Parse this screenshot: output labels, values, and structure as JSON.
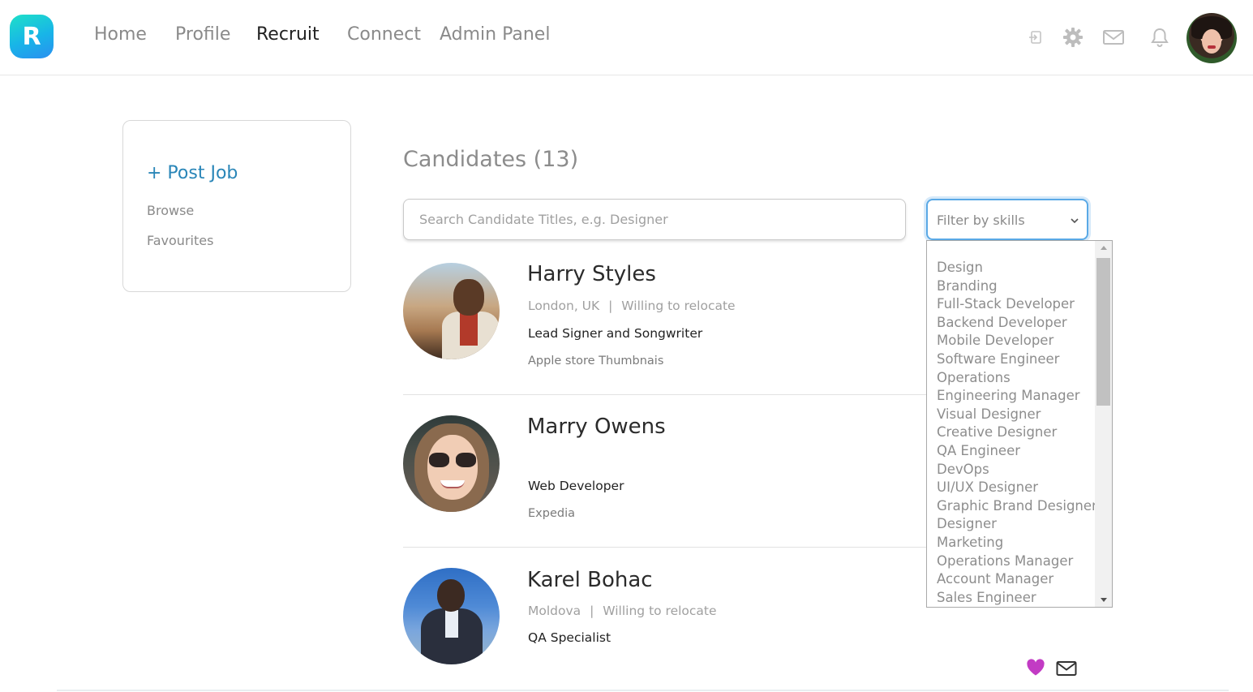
{
  "app": {
    "logo_letter": "R",
    "brand_gradient": [
      "#1ee0c8",
      "#2a8ff0"
    ]
  },
  "nav": {
    "items": [
      {
        "label": "Home",
        "active": false
      },
      {
        "label": "Profile",
        "active": false
      },
      {
        "label": "Recruit",
        "active": true
      },
      {
        "label": "Connect",
        "active": false
      },
      {
        "label": "Admin Panel",
        "active": false
      }
    ]
  },
  "header_icons": [
    "sign-in-icon",
    "gear-icon",
    "mail-icon",
    "bell-icon",
    "avatar"
  ],
  "sidebar": {
    "post_job": "+ Post Job",
    "links": [
      "Browse",
      "Favourites"
    ]
  },
  "main": {
    "title": "Candidates (13)",
    "search": {
      "placeholder": "Search Candidate Titles, e.g. Designer",
      "value": ""
    },
    "filter": {
      "label": "Filter by skills",
      "options": [
        "Design",
        "Branding",
        "Full-Stack Developer",
        "Backend Developer",
        "Mobile Developer",
        "Software Engineer",
        "Operations",
        "Engineering Manager",
        "Visual Designer",
        "Creative Designer",
        "QA Engineer",
        "DevOps",
        "UI/UX Designer",
        "Graphic Brand Designer",
        "Designer",
        "Marketing",
        "Operations Manager",
        "Account Manager",
        "Sales Engineer"
      ]
    },
    "candidates": [
      {
        "name": "Harry Styles",
        "location": "London, UK",
        "relocate": "Willing to relocate",
        "role": "Lead Signer and Songwriter",
        "company": "Apple store Thumbnais"
      },
      {
        "name": "Marry Owens",
        "location": "",
        "relocate": "",
        "role": "Web Developer",
        "company": "Expedia"
      },
      {
        "name": "Karel Bohac",
        "location": "Moldova",
        "relocate": "Willing to relocate",
        "role": "QA Specialist",
        "company": ""
      }
    ],
    "separator": "|"
  },
  "colors": {
    "accent_link": "#2a86b8",
    "focus_ring": "#5aa9e6",
    "heart": "#c23bc4"
  }
}
